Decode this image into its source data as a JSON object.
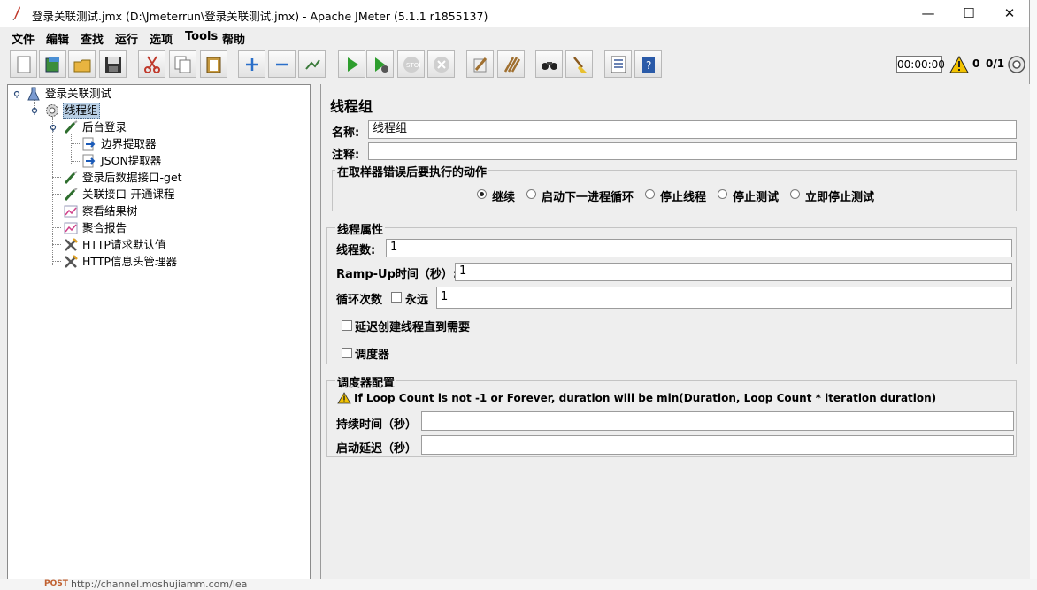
{
  "window": {
    "title": "登录关联测试.jmx (D:\\Jmeterrun\\登录关联测试.jmx) - Apache JMeter (5.1.1 r1855137)",
    "minimize": "—",
    "maximize": "☐",
    "close": "✕"
  },
  "menu": [
    "文件",
    "编辑",
    "查找",
    "运行",
    "选项",
    "Tools",
    "帮助"
  ],
  "toolbar": {
    "buttons": [
      "new-icon",
      "templates-icon",
      "open-icon",
      "save-icon",
      "cut-icon",
      "copy-icon",
      "paste-icon",
      "expand-icon",
      "collapse-icon",
      "toggle-icon",
      "start-icon",
      "start-no-pause-icon",
      "stop-icon",
      "shutdown-icon",
      "clear-icon",
      "clear-all-icon",
      "search-icon",
      "reset-search-icon",
      "function-helper-icon",
      "help-icon"
    ],
    "timer": "00:00:00",
    "warn_count": "0",
    "threads": "0/1"
  },
  "tree": {
    "nodes": [
      {
        "label": "登录关联测试",
        "icon": "testplan-icon"
      },
      {
        "label": "线程组",
        "icon": "gear-icon",
        "selected": true
      },
      {
        "label": "后台登录",
        "icon": "sampler-icon"
      },
      {
        "label": "边界提取器",
        "icon": "extractor-icon"
      },
      {
        "label": "JSON提取器",
        "icon": "extractor-icon"
      },
      {
        "label": "登录后数据接口-get",
        "icon": "sampler-icon"
      },
      {
        "label": "关联接口-开通课程",
        "icon": "sampler-icon"
      },
      {
        "label": "察看结果树",
        "icon": "listener-icon"
      },
      {
        "label": "聚合报告",
        "icon": "listener-icon"
      },
      {
        "label": "HTTP请求默认值",
        "icon": "config-icon"
      },
      {
        "label": "HTTP信息头管理器",
        "icon": "config-icon"
      }
    ]
  },
  "panel": {
    "title": "线程组",
    "name_label": "名称:",
    "name_value": "线程组",
    "comment_label": "注释:",
    "comment_value": "",
    "error_action": {
      "title": "在取样器错误后要执行的动作",
      "options": [
        "继续",
        "启动下一进程循环",
        "停止线程",
        "停止测试",
        "立即停止测试"
      ],
      "selected": 0
    },
    "thread_props": {
      "title": "线程属性",
      "threads_label": "线程数:",
      "threads_value": "1",
      "rampup_label": "Ramp-Up时间（秒）:",
      "rampup_value": "1",
      "loop_label": "循环次数",
      "forever_label": "永远",
      "loop_value": "1",
      "delay_label": "延迟创建线程直到需要",
      "scheduler_label": "调度器"
    },
    "scheduler": {
      "title": "调度器配置",
      "warning": "If Loop Count is not -1 or Forever, duration will be min(Duration, Loop Count * iteration duration)",
      "duration_label": "持续时间（秒）",
      "duration_value": "",
      "delay_label": "启动延迟（秒）",
      "delay_value": ""
    }
  },
  "background": {
    "method": "POST",
    "url": "http://channel.moshujiamm.com/lea"
  }
}
